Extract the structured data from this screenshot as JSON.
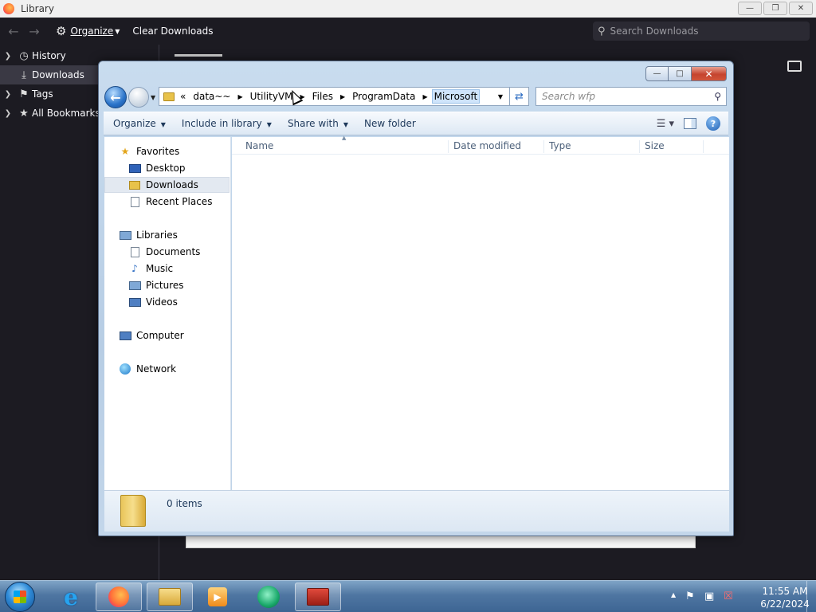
{
  "library": {
    "title": "Library",
    "toolbar": {
      "organize": "Organize",
      "clear_downloads": "Clear Downloads",
      "search_placeholder": "Search Downloads"
    },
    "sidebar": [
      {
        "label": "History",
        "icon": "clock-icon",
        "has_twisty": true
      },
      {
        "label": "Downloads",
        "icon": "download-icon",
        "has_twisty": false,
        "selected": true
      },
      {
        "label": "Tags",
        "icon": "tag-icon",
        "has_twisty": true
      },
      {
        "label": "All Bookmarks",
        "icon": "star-icon",
        "has_twisty": true
      }
    ]
  },
  "dialog": {
    "address": {
      "overflow": "«",
      "crumbs": [
        "data~~",
        "UtilityVM",
        "Files",
        "ProgramData",
        "Microsoft"
      ]
    },
    "search_placeholder": "Search wfp",
    "commands": [
      {
        "label": "Organize",
        "dropdown": true
      },
      {
        "label": "Include in library",
        "dropdown": true
      },
      {
        "label": "Share with",
        "dropdown": true
      },
      {
        "label": "New folder",
        "dropdown": false
      }
    ],
    "nav": {
      "favorites": "Favorites",
      "desktop": "Desktop",
      "downloads": "Downloads",
      "recent": "Recent Places",
      "libraries": "Libraries",
      "documents": "Documents",
      "music": "Music",
      "pictures": "Pictures",
      "videos": "Videos",
      "computer": "Computer",
      "network": "Network"
    },
    "columns": [
      "Name",
      "Date modified",
      "Type",
      "Size"
    ],
    "details": {
      "count": "0 items"
    }
  },
  "taskbar": {
    "clock_time": "11:55 AM",
    "clock_date": "6/22/2024"
  },
  "colors": {
    "firefox_bg": "#1c1b22",
    "dialog_frame": "#b7cde4",
    "taskbar": "#4f76a2"
  }
}
